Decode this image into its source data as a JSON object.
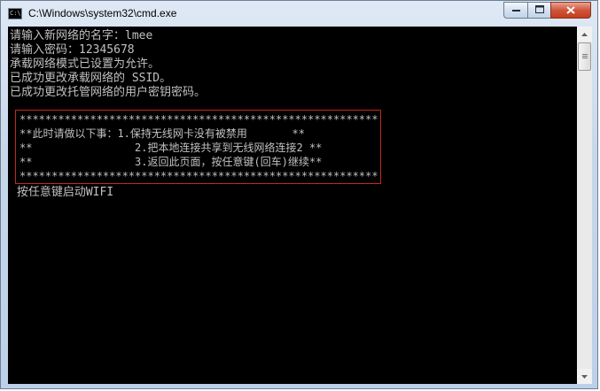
{
  "window": {
    "title": "C:\\Windows\\system32\\cmd.exe",
    "icon_label": "C:\\",
    "buttons": {
      "minimize": "minimize-icon",
      "maximize": "maximize-icon",
      "close": "close-icon"
    }
  },
  "console": {
    "lines": [
      "请输入新网络的名字：lmee",
      "请输入密码：12345678",
      "承载网络模式已设置为允许。",
      "已成功更改承载网络的 SSID。",
      "已成功更改托管网络的用户密钥密码。"
    ],
    "box_lines": [
      "**************************************************************",
      "**此时请做以下事：1.保持无线网卡没有被禁用       **",
      "**                2.把本地连接共享到无线网络连接2 **",
      "**                3.返回此页面，按任意键(回车)继续**",
      "**************************************************************"
    ],
    "prompt": " 按任意键启动WIFI"
  },
  "colors": {
    "console_bg": "#000000",
    "console_text": "#c0c0c0",
    "highlight_border": "#c8241c"
  }
}
